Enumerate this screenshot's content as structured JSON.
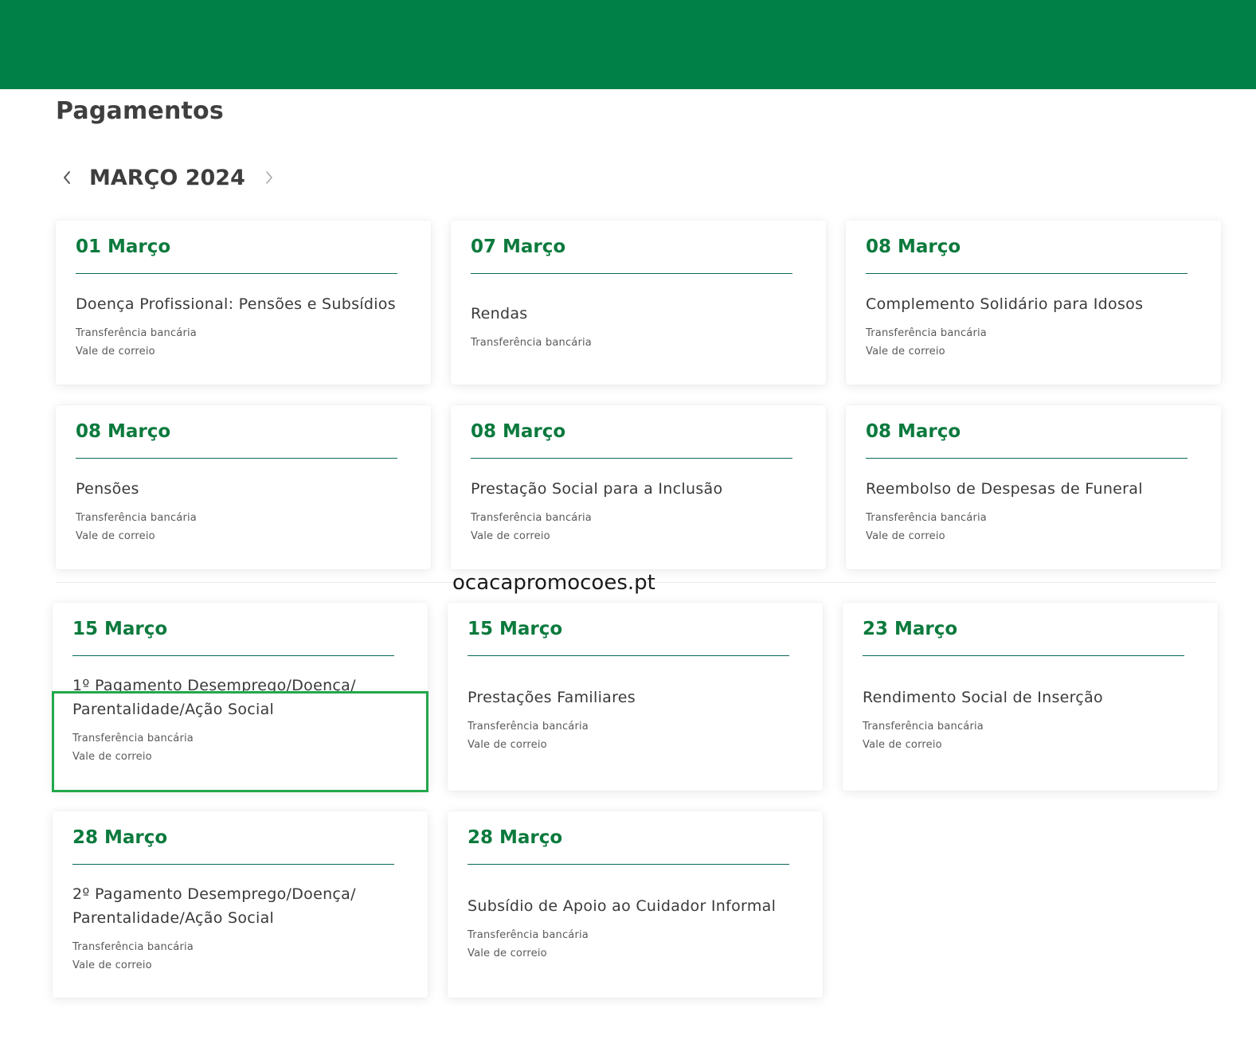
{
  "header": {
    "page_title": "Pagamentos"
  },
  "calendar": {
    "month_label": "MARÇO 2024",
    "prev_icon": "chevron-left-icon",
    "next_icon": "chevron-right-icon"
  },
  "cards": [
    {
      "date": "01 Março",
      "title": "Doença Profissional: Pensões e Subsídios",
      "methods": [
        "Transferência bancária",
        "Vale de correio"
      ]
    },
    {
      "date": "07 Março",
      "title": "Rendas",
      "methods": [
        "Transferência bancária"
      ]
    },
    {
      "date": "08 Março",
      "title": "Complemento Solidário para Idosos",
      "methods": [
        "Transferência bancária",
        "Vale de correio"
      ]
    },
    {
      "date": "08 Março",
      "title": "Pensões",
      "methods": [
        "Transferência bancária",
        "Vale de correio"
      ]
    },
    {
      "date": "08 Março",
      "title": "Prestação Social para a Inclusão",
      "methods": [
        "Transferência bancária",
        "Vale de correio"
      ]
    },
    {
      "date": "08 Março",
      "title": "Reembolso de Despesas de Funeral",
      "methods": [
        "Transferência bancária",
        "Vale de correio"
      ]
    },
    {
      "date": "15 Março",
      "title_lines": [
        "1º Pagamento Desemprego/Doença/",
        "Parentalidade/Ação Social"
      ],
      "methods": [
        "Transferência bancária",
        "Vale de correio"
      ]
    },
    {
      "date": "15 Março",
      "title": "Prestações Familiares",
      "methods": [
        "Transferência bancária",
        "Vale de correio"
      ]
    },
    {
      "date": "23 Março",
      "title": "Rendimento Social de Inserção",
      "methods": [
        "Transferência bancária",
        "Vale de correio"
      ]
    },
    {
      "date": "28 Março",
      "title_lines": [
        "2º Pagamento Desemprego/Doença/",
        "Parentalidade/Ação Social"
      ],
      "methods": [
        "Transferência bancária",
        "Vale de correio"
      ]
    },
    {
      "date": "28 Março",
      "title": "Subsídio de Apoio ao Cuidador Informal",
      "methods": [
        "Transferência bancária",
        "Vale de correio"
      ]
    }
  ],
  "watermark": {
    "text": "ocacapromocoes.pt"
  },
  "colors": {
    "header_green": "#008046",
    "date_green": "#0c7a3d",
    "highlight_green": "#22a84a"
  }
}
